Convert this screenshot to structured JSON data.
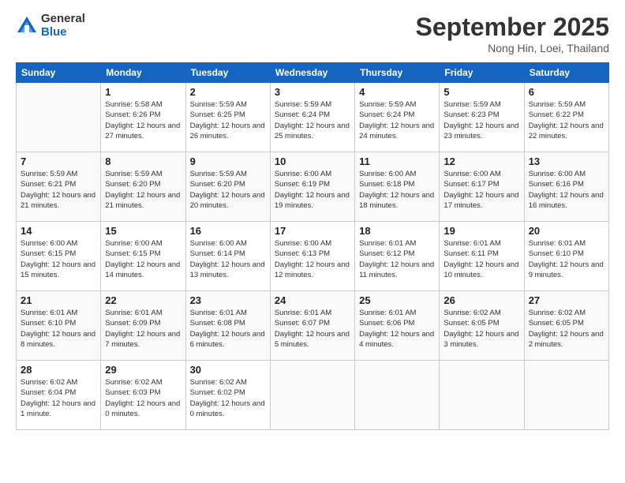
{
  "logo": {
    "general": "General",
    "blue": "Blue"
  },
  "header": {
    "month": "September 2025",
    "location": "Nong Hin, Loei, Thailand"
  },
  "days": [
    "Sunday",
    "Monday",
    "Tuesday",
    "Wednesday",
    "Thursday",
    "Friday",
    "Saturday"
  ],
  "weeks": [
    [
      {
        "date": "",
        "sunrise": "",
        "sunset": "",
        "daylight": ""
      },
      {
        "date": "1",
        "sunrise": "Sunrise: 5:58 AM",
        "sunset": "Sunset: 6:26 PM",
        "daylight": "Daylight: 12 hours and 27 minutes."
      },
      {
        "date": "2",
        "sunrise": "Sunrise: 5:59 AM",
        "sunset": "Sunset: 6:25 PM",
        "daylight": "Daylight: 12 hours and 26 minutes."
      },
      {
        "date": "3",
        "sunrise": "Sunrise: 5:59 AM",
        "sunset": "Sunset: 6:24 PM",
        "daylight": "Daylight: 12 hours and 25 minutes."
      },
      {
        "date": "4",
        "sunrise": "Sunrise: 5:59 AM",
        "sunset": "Sunset: 6:24 PM",
        "daylight": "Daylight: 12 hours and 24 minutes."
      },
      {
        "date": "5",
        "sunrise": "Sunrise: 5:59 AM",
        "sunset": "Sunset: 6:23 PM",
        "daylight": "Daylight: 12 hours and 23 minutes."
      },
      {
        "date": "6",
        "sunrise": "Sunrise: 5:59 AM",
        "sunset": "Sunset: 6:22 PM",
        "daylight": "Daylight: 12 hours and 22 minutes."
      }
    ],
    [
      {
        "date": "7",
        "sunrise": "Sunrise: 5:59 AM",
        "sunset": "Sunset: 6:21 PM",
        "daylight": "Daylight: 12 hours and 21 minutes."
      },
      {
        "date": "8",
        "sunrise": "Sunrise: 5:59 AM",
        "sunset": "Sunset: 6:20 PM",
        "daylight": "Daylight: 12 hours and 21 minutes."
      },
      {
        "date": "9",
        "sunrise": "Sunrise: 5:59 AM",
        "sunset": "Sunset: 6:20 PM",
        "daylight": "Daylight: 12 hours and 20 minutes."
      },
      {
        "date": "10",
        "sunrise": "Sunrise: 6:00 AM",
        "sunset": "Sunset: 6:19 PM",
        "daylight": "Daylight: 12 hours and 19 minutes."
      },
      {
        "date": "11",
        "sunrise": "Sunrise: 6:00 AM",
        "sunset": "Sunset: 6:18 PM",
        "daylight": "Daylight: 12 hours and 18 minutes."
      },
      {
        "date": "12",
        "sunrise": "Sunrise: 6:00 AM",
        "sunset": "Sunset: 6:17 PM",
        "daylight": "Daylight: 12 hours and 17 minutes."
      },
      {
        "date": "13",
        "sunrise": "Sunrise: 6:00 AM",
        "sunset": "Sunset: 6:16 PM",
        "daylight": "Daylight: 12 hours and 16 minutes."
      }
    ],
    [
      {
        "date": "14",
        "sunrise": "Sunrise: 6:00 AM",
        "sunset": "Sunset: 6:15 PM",
        "daylight": "Daylight: 12 hours and 15 minutes."
      },
      {
        "date": "15",
        "sunrise": "Sunrise: 6:00 AM",
        "sunset": "Sunset: 6:15 PM",
        "daylight": "Daylight: 12 hours and 14 minutes."
      },
      {
        "date": "16",
        "sunrise": "Sunrise: 6:00 AM",
        "sunset": "Sunset: 6:14 PM",
        "daylight": "Daylight: 12 hours and 13 minutes."
      },
      {
        "date": "17",
        "sunrise": "Sunrise: 6:00 AM",
        "sunset": "Sunset: 6:13 PM",
        "daylight": "Daylight: 12 hours and 12 minutes."
      },
      {
        "date": "18",
        "sunrise": "Sunrise: 6:01 AM",
        "sunset": "Sunset: 6:12 PM",
        "daylight": "Daylight: 12 hours and 11 minutes."
      },
      {
        "date": "19",
        "sunrise": "Sunrise: 6:01 AM",
        "sunset": "Sunset: 6:11 PM",
        "daylight": "Daylight: 12 hours and 10 minutes."
      },
      {
        "date": "20",
        "sunrise": "Sunrise: 6:01 AM",
        "sunset": "Sunset: 6:10 PM",
        "daylight": "Daylight: 12 hours and 9 minutes."
      }
    ],
    [
      {
        "date": "21",
        "sunrise": "Sunrise: 6:01 AM",
        "sunset": "Sunset: 6:10 PM",
        "daylight": "Daylight: 12 hours and 8 minutes."
      },
      {
        "date": "22",
        "sunrise": "Sunrise: 6:01 AM",
        "sunset": "Sunset: 6:09 PM",
        "daylight": "Daylight: 12 hours and 7 minutes."
      },
      {
        "date": "23",
        "sunrise": "Sunrise: 6:01 AM",
        "sunset": "Sunset: 6:08 PM",
        "daylight": "Daylight: 12 hours and 6 minutes."
      },
      {
        "date": "24",
        "sunrise": "Sunrise: 6:01 AM",
        "sunset": "Sunset: 6:07 PM",
        "daylight": "Daylight: 12 hours and 5 minutes."
      },
      {
        "date": "25",
        "sunrise": "Sunrise: 6:01 AM",
        "sunset": "Sunset: 6:06 PM",
        "daylight": "Daylight: 12 hours and 4 minutes."
      },
      {
        "date": "26",
        "sunrise": "Sunrise: 6:02 AM",
        "sunset": "Sunset: 6:05 PM",
        "daylight": "Daylight: 12 hours and 3 minutes."
      },
      {
        "date": "27",
        "sunrise": "Sunrise: 6:02 AM",
        "sunset": "Sunset: 6:05 PM",
        "daylight": "Daylight: 12 hours and 2 minutes."
      }
    ],
    [
      {
        "date": "28",
        "sunrise": "Sunrise: 6:02 AM",
        "sunset": "Sunset: 6:04 PM",
        "daylight": "Daylight: 12 hours and 1 minute."
      },
      {
        "date": "29",
        "sunrise": "Sunrise: 6:02 AM",
        "sunset": "Sunset: 6:03 PM",
        "daylight": "Daylight: 12 hours and 0 minutes."
      },
      {
        "date": "30",
        "sunrise": "Sunrise: 6:02 AM",
        "sunset": "Sunset: 6:02 PM",
        "daylight": "Daylight: 12 hours and 0 minutes."
      },
      {
        "date": "",
        "sunrise": "",
        "sunset": "",
        "daylight": ""
      },
      {
        "date": "",
        "sunrise": "",
        "sunset": "",
        "daylight": ""
      },
      {
        "date": "",
        "sunrise": "",
        "sunset": "",
        "daylight": ""
      },
      {
        "date": "",
        "sunrise": "",
        "sunset": "",
        "daylight": ""
      }
    ]
  ]
}
